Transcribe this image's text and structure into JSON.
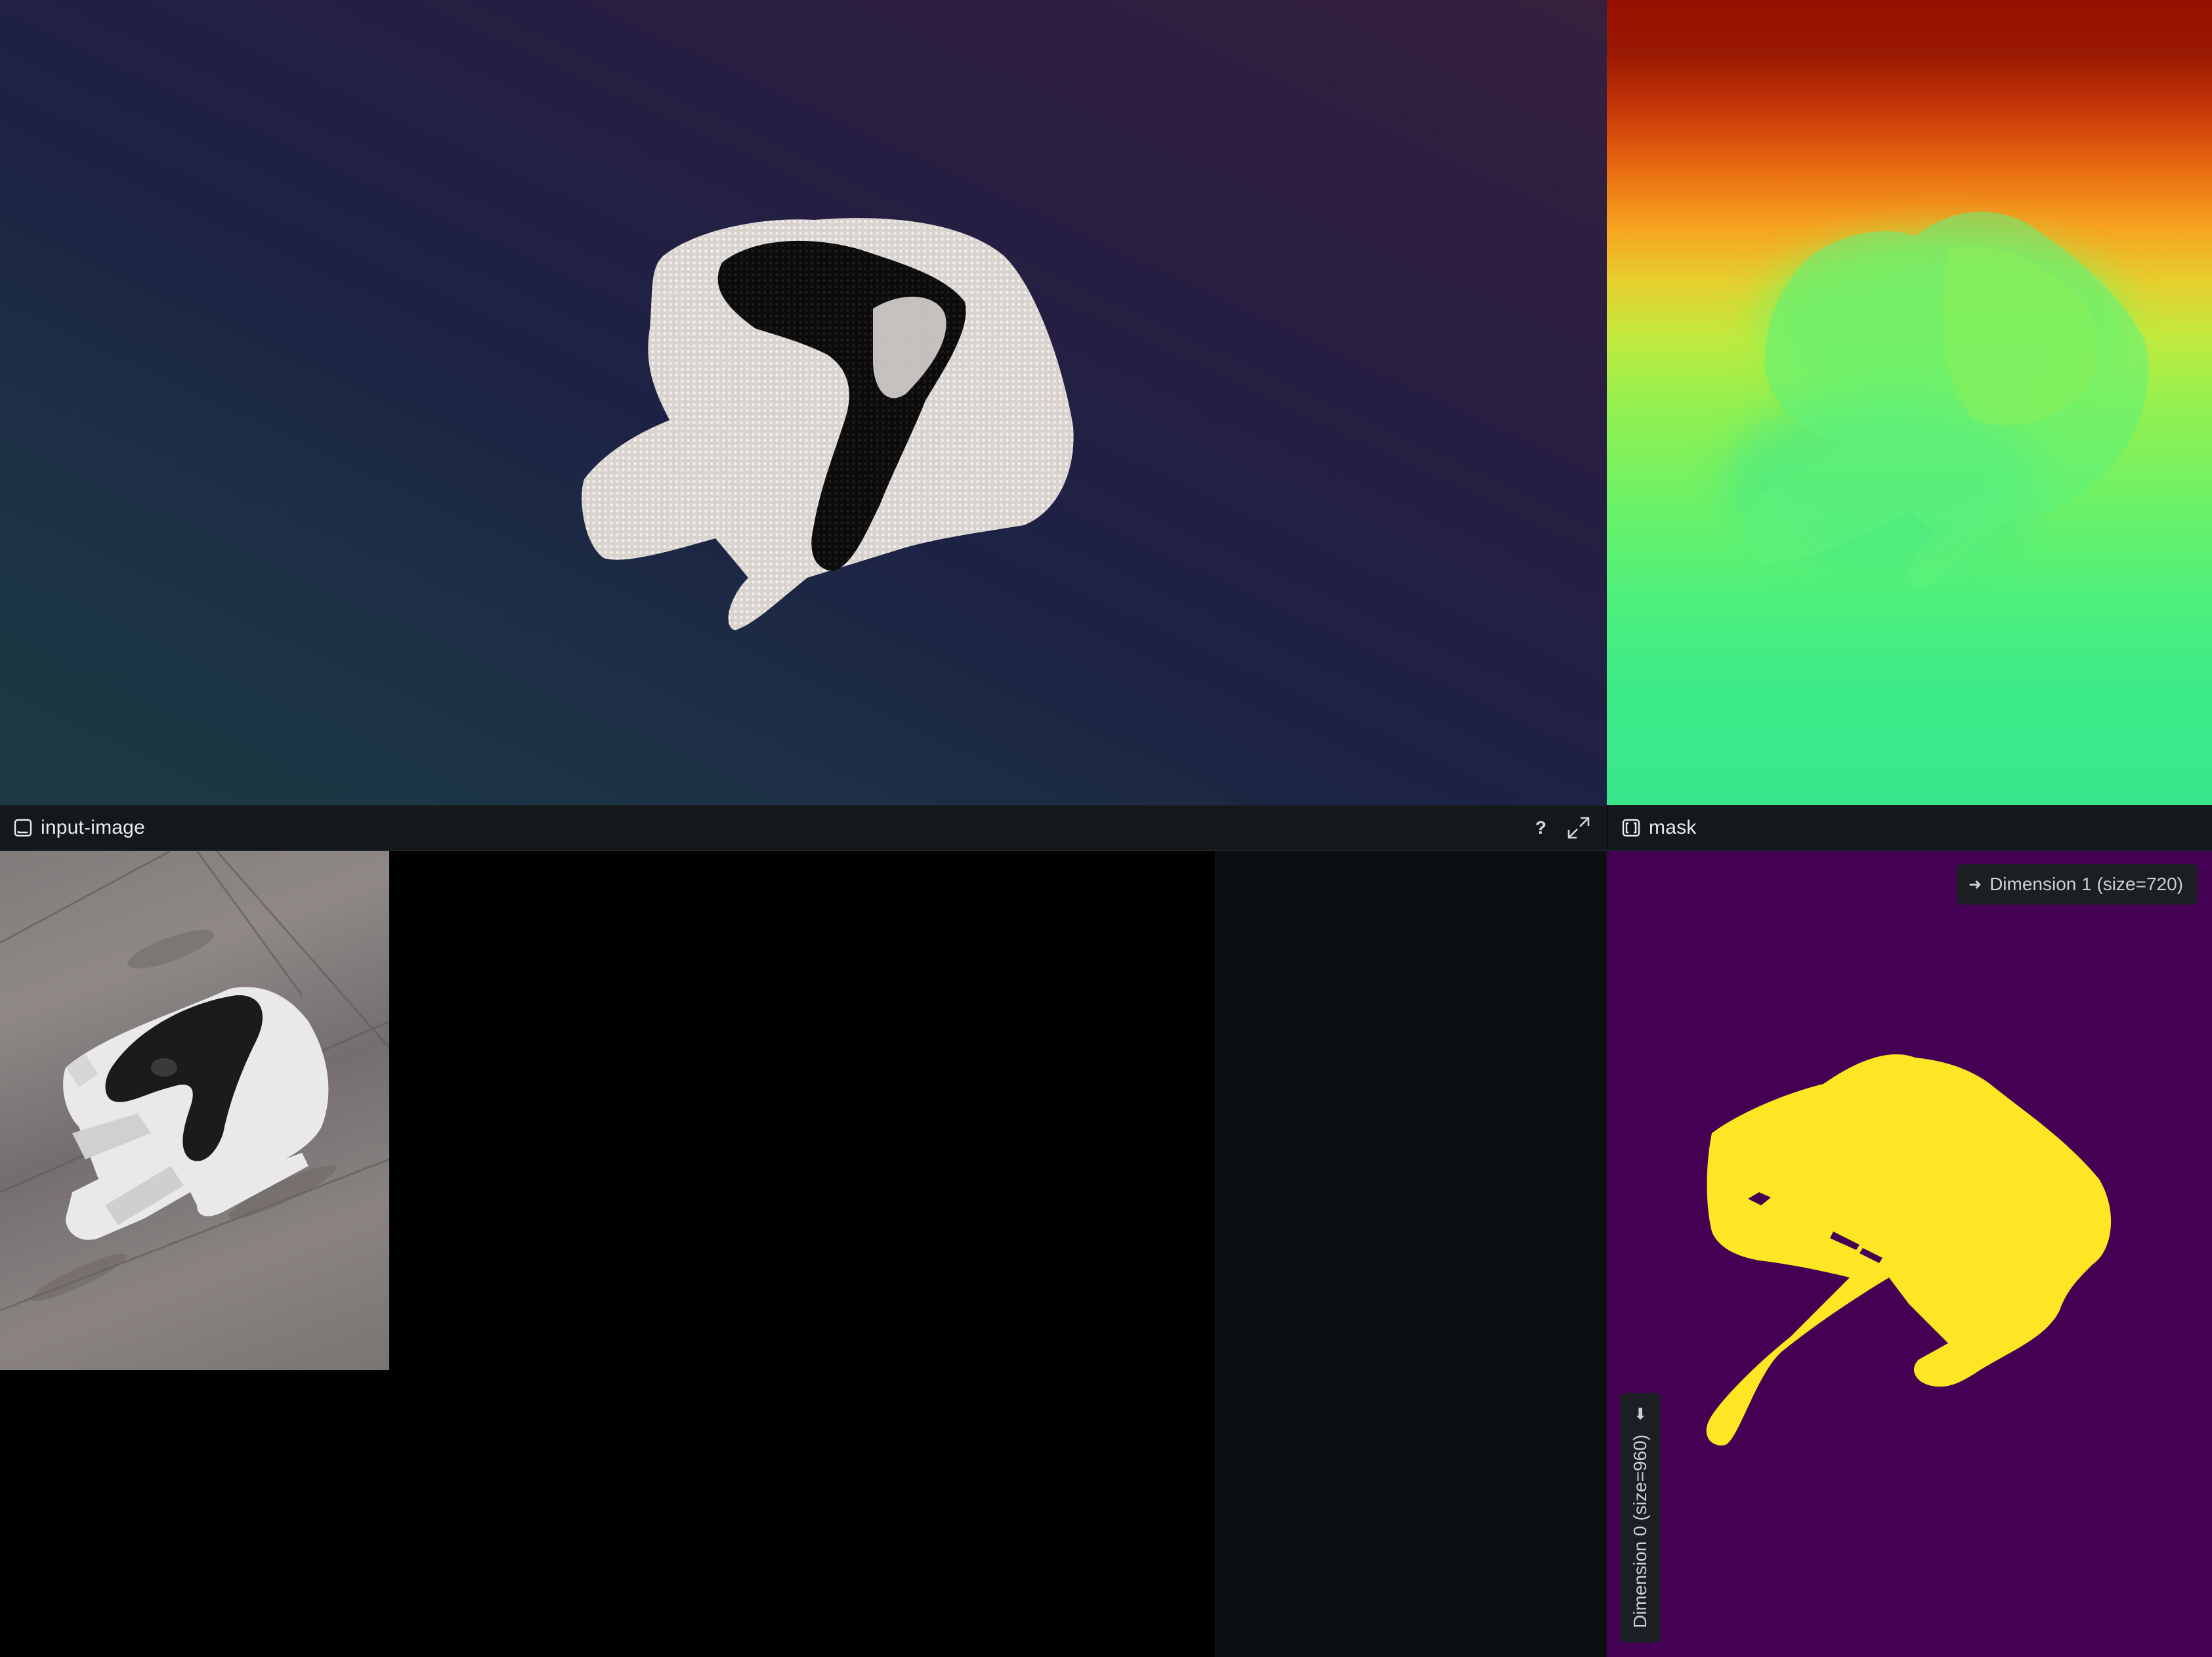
{
  "panels": {
    "input_image": {
      "title": "input-image",
      "icon": "image-panel-icon",
      "tools": {
        "help_label": "?",
        "maximize_icon": "maximize-icon"
      }
    },
    "mask": {
      "title": "mask",
      "icon": "tensor-panel-icon",
      "dim1_label": "Dimension 1 (size=720)",
      "dim0_label": "Dimension 0 (size=960)",
      "dim1_arrow": "➜",
      "dim0_arrow": "⬇"
    }
  },
  "colors": {
    "mask_background": "#440154",
    "mask_foreground": "#fde725",
    "header_background": "#15181b",
    "header_text": "#e8ecef"
  }
}
